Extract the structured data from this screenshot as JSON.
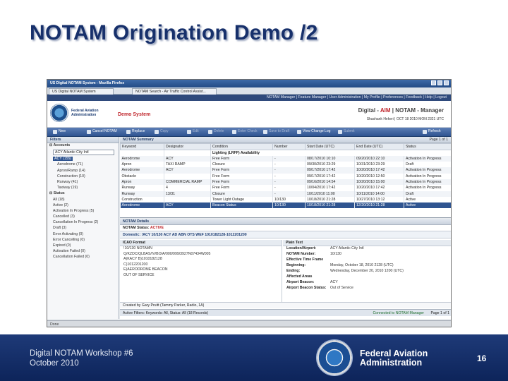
{
  "slide": {
    "title": "NOTAM Origination Demo /2"
  },
  "window": {
    "title": "US Digital NOTAM System - Mozilla Firefox",
    "tabs": [
      "US Digital NOTAM System",
      "NOTAM Search - Air Traffic Control Assist..."
    ],
    "top_nav": "NOTAM Manager | Feature Manager | User Administration | My Profile | Preferences | Feedback | Help | Logout"
  },
  "app": {
    "agency": "Federal Aviation Administration",
    "demo_label": "Demo System",
    "brand_prefix": "Digital - ",
    "brand_red": "AIM",
    "brand_suffix": " | NOTAM - Manager",
    "user_line": "Shashank Hekeri | OCT 18 2010 MON 2321 UTC"
  },
  "toolbar": {
    "items": [
      "New",
      "Cancel NOTAM",
      "Replace",
      "Copy",
      "Edit",
      "Delete",
      "Enter Check",
      "Save to Draft",
      "View Change Log",
      "Submit"
    ],
    "refresh": "Refresh"
  },
  "filters": {
    "header": "Filters",
    "group_accounts": "Accounts",
    "account_select": "ACY Atlantic City Intl",
    "tree": [
      {
        "label": "ACY (155)",
        "level": "sub",
        "selected": true
      },
      {
        "label": "Aerodrome (71)",
        "level": "sub"
      },
      {
        "label": "Apron/Ramp (14)",
        "level": "sub"
      },
      {
        "label": "Construction (10)",
        "level": "sub"
      },
      {
        "label": "Runway (41)",
        "level": "sub"
      },
      {
        "label": "Taxiway (19)",
        "level": "sub"
      }
    ],
    "group_status": "Status",
    "status_items": [
      "All (18)",
      "Active (2)",
      "Activation In Progress (5)",
      "Cancelled (3)",
      "Cancellation In Progress (2)",
      "Draft (3)",
      "Error Activating (0)",
      "Error Cancelling (0)",
      "Expired (0)",
      "Activation Failed (0)",
      "Cancellation Failed (0)"
    ]
  },
  "summary": {
    "header": "NOTAM Summary",
    "pager": "Page 1 of 1",
    "columns": [
      "Keyword",
      "Designator",
      "Condition",
      "Number",
      "Start Date (UTC)",
      "End Date (UTC)",
      "Status"
    ],
    "group_label": "Lighting (LRFF) Availability",
    "rows": [
      [
        "Aerodrome",
        "ACY",
        "Free Form",
        "-",
        "08/17/2010 10:10",
        "09/20/2010 22:10",
        "Activation In Progress"
      ],
      [
        "Apron",
        "TAXI RAMP",
        "Closure",
        "-",
        "09/30/2010 23:29",
        "10/31/2010 23:29",
        "Draft"
      ],
      [
        "Aerodrome",
        "ACY",
        "Free Form",
        "-",
        "09/17/2010 17:42",
        "10/20/2010 17:42",
        "Activation In Progress"
      ],
      [
        "Obstacle",
        "",
        "Free Form",
        "-",
        "09/17/2010 17:42",
        "10/20/2010 12:50",
        "Activation In Progress"
      ],
      [
        "Apron",
        "COMMERCIAL RAMP",
        "Free Form",
        "-",
        "09/16/2010 14:54",
        "10/20/2010 15:00",
        "Activation In Progress"
      ],
      [
        "Runway",
        "4",
        "Free Form",
        "-",
        "10/04/2010 17:42",
        "10/20/2010 17:42",
        "Activation In Progress"
      ],
      [
        "Runway",
        "13/31",
        "Closure",
        "-",
        "10/11/2010 11:00",
        "10/11/2010 14:00",
        "Draft"
      ],
      [
        "Construction",
        "",
        "Tower Light Outage",
        "10/130",
        "10/18/2010 21:28",
        "10/27/2010 13:12",
        "Active"
      ],
      [
        "Aerodrome",
        "ACY",
        "Beacon Status",
        "10/130",
        "10/18/2010 21:28",
        "12/20/2010 21:28",
        "Active"
      ]
    ]
  },
  "details": {
    "header": "NOTAM Details",
    "status_label": "NOTAM Status: ",
    "status_value": "ACTIVE",
    "domestic": "Domestic: !ACY 10/130 ACY AD ABN OTS WEF 1010182128-1012201200",
    "icao_header": "ICAO Format",
    "icao_lines": [
      "Q/KZDC/QLBAS/IV/BO/A/000/999/3927N07434W005",
      "A)KACY B)1010182128",
      "C)1012201200",
      "E)AERODROME BEACON",
      "OUT OF SERVICE"
    ],
    "icao_number": "!10/130 NOTAMN",
    "plain_header": "Plain Text",
    "plain": [
      {
        "k": "Location/Airport:",
        "v": "ACY Atlantic City Intl"
      },
      {
        "k": "NOTAM Number:",
        "v": "10/130"
      },
      {
        "k": "Effective Time Frame",
        "v": ""
      },
      {
        "k": "Beginning:",
        "v": "Monday, October 18, 2010 2128 (UTC)"
      },
      {
        "k": "Ending:",
        "v": "Wednesday, December 20, 2010 1200 (UTC)"
      },
      {
        "k": "Affected Areas",
        "v": ""
      },
      {
        "k": "Airport Beacon:",
        "v": "ACY"
      },
      {
        "k": "Airport Beacon Status:",
        "v": "Out of Service"
      }
    ],
    "created_by": "Created by Gary Pruitt (Tammy Parker, Radio, 1A)",
    "active_filters": "Active Filters: Keywords: All, Status: All (18 Records)",
    "connected": "Connected to NOTAM Manager",
    "page": "Page 1 of 1"
  },
  "statusbar": {
    "text": "Done"
  },
  "footer": {
    "event": "Digital NOTAM Workshop #6",
    "date": "October 2010",
    "agency_line1": "Federal Aviation",
    "agency_line2": "Administration",
    "slide_number": "16"
  }
}
